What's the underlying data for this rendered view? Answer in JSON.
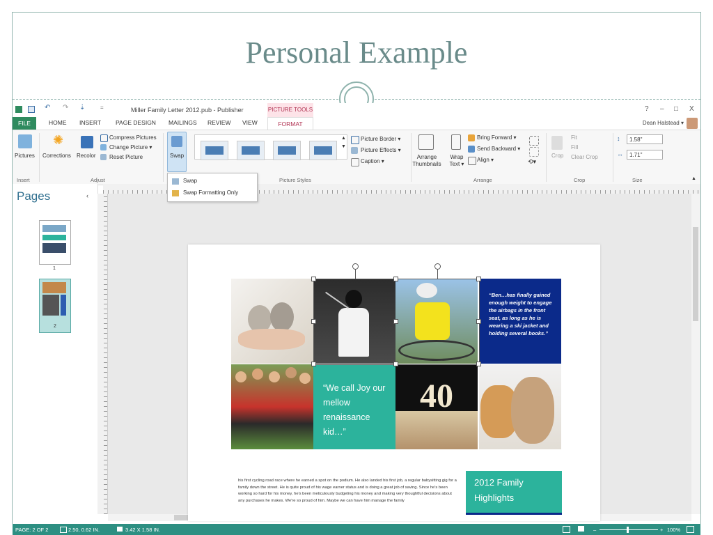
{
  "slide": {
    "title": "Personal Example"
  },
  "window": {
    "title": "Miller Family Letter 2012.pub - Publisher",
    "contextual_tab": "PICTURE TOOLS",
    "help": "?",
    "minimize": "–",
    "restore": "□",
    "close": "X"
  },
  "tabs": [
    "FILE",
    "HOME",
    "INSERT",
    "PAGE DESIGN",
    "MAILINGS",
    "REVIEW",
    "VIEW",
    "FORMAT"
  ],
  "user": {
    "name": "Dean Halstead ▾"
  },
  "ribbon": {
    "insert": {
      "pictures": "Pictures",
      "group": "Insert"
    },
    "adjust": {
      "corrections": "Corrections",
      "recolor": "Recolor",
      "compress": "Compress Pictures",
      "change": "Change Picture ▾",
      "reset": "Reset Picture",
      "group": "Adjust"
    },
    "swap": {
      "label": "Swap"
    },
    "styles": {
      "border": "Picture Border ▾",
      "effects": "Picture Effects ▾",
      "caption": "Caption ▾",
      "group": "Picture Styles"
    },
    "arrange": {
      "thumbnails": "Arrange Thumbnails",
      "wrap": "Wrap Text ▾",
      "forward": "Bring Forward ▾",
      "backward": "Send Backward ▾",
      "align": "Align ▾",
      "group": "Arrange"
    },
    "crop": {
      "crop": "Crop",
      "fit": "Fit",
      "fill": "Fill",
      "clear": "Clear Crop",
      "group": "Crop"
    },
    "size": {
      "height": "1.58\"",
      "width": "1.71\"",
      "group": "Size"
    }
  },
  "swap_menu": {
    "item1": "Swap",
    "item2": "Swap Formatting Only"
  },
  "pages_pane": {
    "title": "Pages",
    "collapse": "‹",
    "page1": "1",
    "page2": "2"
  },
  "document": {
    "quote_teal": "“We call Joy our mellow renaissance kid…”",
    "quote_blue": "“Ben…has finally gained enough weight to engage the airbags in the front seat, as long as he is wearing a ski jacket and holding several books.”",
    "body": "his first cycling road race where he earned a spot on the podium. He also landed his first job, a regular babysitting gig for a family down the street. He is quite proud of his wage earner status and is doing a great job of saving. Since he's been working so hard for his money, he's been meticulously budgeting his money and making very thoughtful decisions about any purchases he makes. We're so proud of him. Maybe we can have him manage the family",
    "highlights": "2012 Family Highlights",
    "cake_number": "40"
  },
  "status": {
    "page": "PAGE: 2 OF 2",
    "position": "2.50, 0.62 IN.",
    "size": "3.42 X 1.58 IN.",
    "zoom": "100%"
  },
  "colors": {
    "teal": "#2cb39c",
    "navy": "#0b2a8a",
    "status_green": "#2d8f82",
    "file_green": "#2f8b5f",
    "title": "#6a8b8a"
  }
}
